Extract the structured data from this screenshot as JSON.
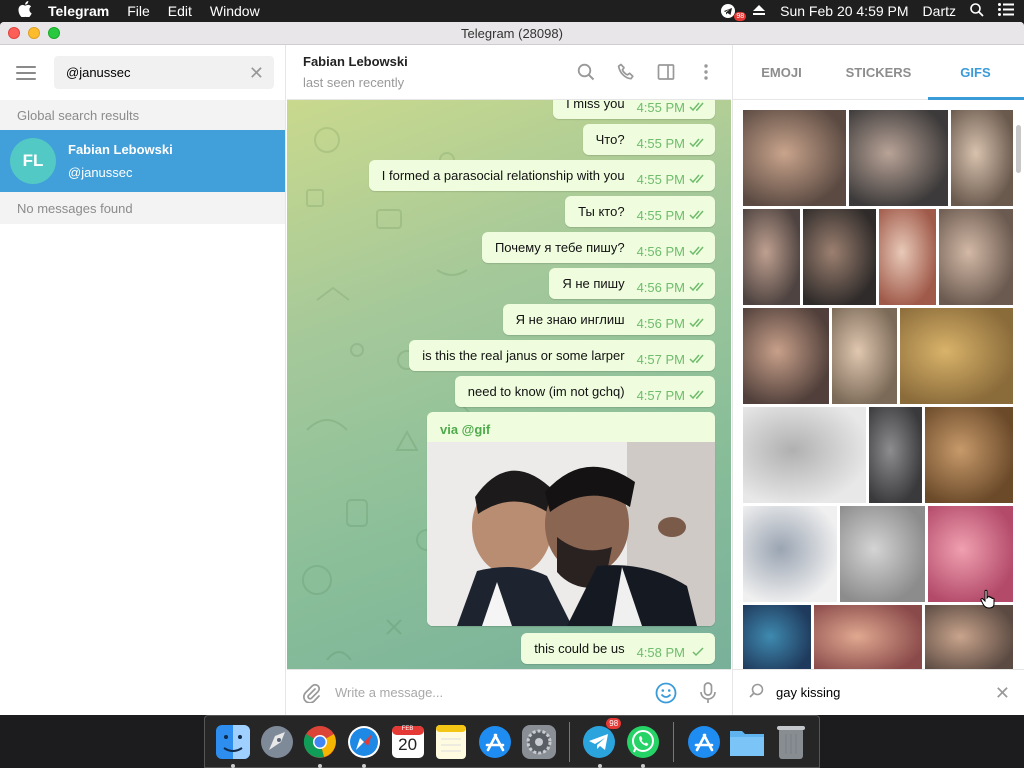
{
  "menubar": {
    "app_name": "Telegram",
    "menus": [
      "File",
      "Edit",
      "Window"
    ],
    "telegram_badge": "98",
    "datetime": "Sun Feb 20  4:59 PM",
    "user": "Dartz"
  },
  "window": {
    "title": "Telegram (28098)"
  },
  "sidebar": {
    "search_value": "@janussec",
    "section_label": "Global search results",
    "result": {
      "initials": "FL",
      "name": "Fabian Lebowski",
      "handle": "@janussec",
      "avatar_color": "#52c9c4"
    },
    "no_messages": "No messages found"
  },
  "chat": {
    "peer_name": "Fabian Lebowski",
    "peer_status": "last seen recently",
    "messages": [
      {
        "text": "I miss you",
        "time": "4:55 PM",
        "read": true
      },
      {
        "text": "Что?",
        "time": "4:55 PM",
        "read": true
      },
      {
        "text": "I formed a parasocial relationship with you",
        "time": "4:55 PM",
        "read": true
      },
      {
        "text": "Ты кто?",
        "time": "4:55 PM",
        "read": true
      },
      {
        "text": "Почему я тебе пишу?",
        "time": "4:56 PM",
        "read": true
      },
      {
        "text": "Я не пишу",
        "time": "4:56 PM",
        "read": true
      },
      {
        "text": "Я не знаю инглиш",
        "time": "4:56 PM",
        "read": true
      },
      {
        "text": "is this the real janus or some larper",
        "time": "4:57 PM",
        "read": true
      },
      {
        "text": "need to know (im not gchq)",
        "time": "4:57 PM",
        "read": true
      },
      {
        "text": "this could be us",
        "time": "4:58 PM",
        "read": false
      }
    ],
    "gif_message": {
      "via": "via @gif"
    },
    "composer_placeholder": "Write a message..."
  },
  "gif_panel": {
    "tabs": [
      "EMOJI",
      "STICKERS",
      "GIFS"
    ],
    "active_tab": "GIFS",
    "search_value": "gay kissing"
  },
  "dock": {
    "items": [
      "finder-icon",
      "launchpad-icon",
      "chrome-icon",
      "safari-icon",
      "calendar-icon",
      "notes-icon",
      "app-store-icon",
      "system-preferences-icon",
      "telegram-icon",
      "whatsapp-icon",
      "app-store-icon",
      "folder-icon",
      "trash-icon"
    ],
    "calendar_day": "20",
    "calendar_month": "FEB",
    "telegram_badge": "98"
  },
  "colors": {
    "accent": "#419fd9",
    "bubble": "#effdde",
    "check": "#6fbc6d"
  }
}
